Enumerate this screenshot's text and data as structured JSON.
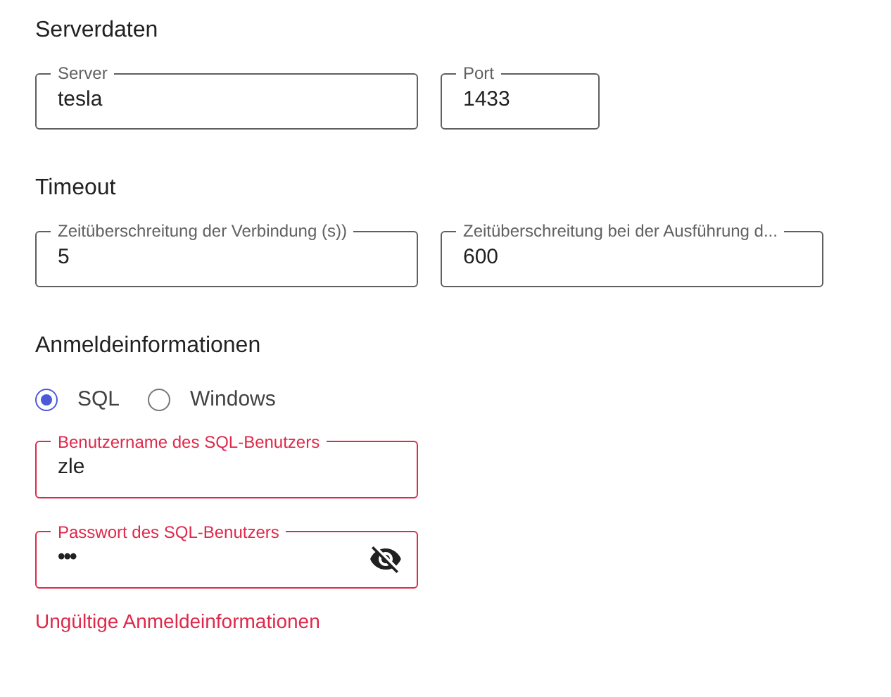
{
  "sections": [
    {
      "title": "Serverdaten",
      "kind": "fields",
      "fields": [
        {
          "label": "Server",
          "value": "tesla",
          "kind": "text",
          "error": false
        },
        {
          "label": "Port",
          "value": "1433",
          "kind": "port",
          "error": false
        }
      ]
    },
    {
      "title": "Timeout",
      "kind": "fields",
      "fields": [
        {
          "label": "Zeitüberschreitung der Verbindung (s))",
          "value": "5",
          "kind": "text",
          "error": false
        },
        {
          "label": "Zeitüberschreitung bei der Ausführung d...",
          "value": "600",
          "kind": "text",
          "error": false
        }
      ]
    },
    {
      "title": "Anmeldeinformationen",
      "kind": "credentials",
      "options": [
        {
          "label": "SQL",
          "selected": true
        },
        {
          "label": "Windows",
          "selected": false
        }
      ],
      "fields": [
        {
          "label": "Benutzername des SQL-Benutzers",
          "value": "zle",
          "kind": "text",
          "error": true
        },
        {
          "label": "Passwort des SQL-Benutzers",
          "value": "•••",
          "error": true,
          "kind": "password",
          "revealed": false
        }
      ],
      "error_message": "Ungültige Anmeldeinformationen"
    }
  ]
}
